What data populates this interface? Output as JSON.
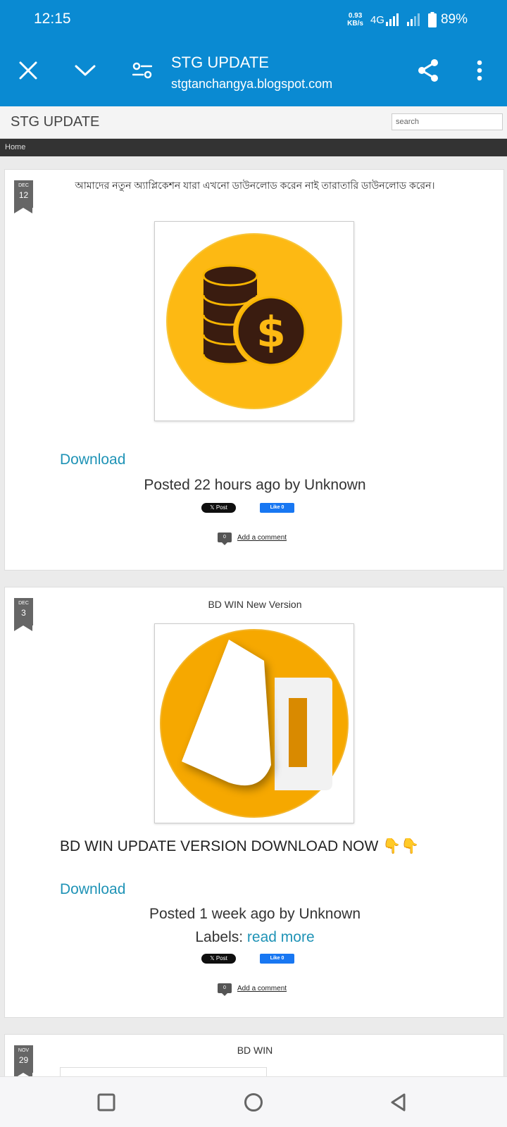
{
  "status_bar": {
    "time": "12:15",
    "net_speed_value": "0.93",
    "net_speed_unit": "KB/s",
    "network": "4G",
    "battery": "89%"
  },
  "toolbar": {
    "title": "STG UPDATE",
    "url": "stgtanchangya.blogspot.com"
  },
  "blog": {
    "title": "STG UPDATE",
    "search_placeholder": "search",
    "nav_home": "Home"
  },
  "posts": [
    {
      "month": "DEC",
      "day": "12",
      "title": "আমাদের নতুন অ্যাপ্লিকেশন যারা এখনো ডাউনলোড করেন নাই তারাতারি ডাউনলোড করেন।",
      "download": "Download",
      "posted": "Posted 22 hours ago by Unknown",
      "x_post": "𝕏 Post",
      "fb_like": "Like 0",
      "comment_count": "0",
      "add_comment": "Add a comment"
    },
    {
      "month": "DEC",
      "day": "3",
      "title": "BD WIN New Version",
      "body": "BD WIN UPDATE VERSION DOWNLOAD NOW 👇👇",
      "download": "Download",
      "posted": "Posted 1 week ago by Unknown",
      "labels_prefix": "Labels: ",
      "labels_link": "read more",
      "x_post": "𝕏 Post",
      "fb_like": "Like 0",
      "comment_count": "0",
      "add_comment": "Add a comment"
    },
    {
      "month": "NOV",
      "day": "29",
      "title": "BD WIN"
    }
  ],
  "colors": {
    "brand_blue": "#0a8ad2",
    "link_teal": "#1f93b6",
    "coin_yellow": "#fdb913",
    "bd_orange": "#f6a800"
  }
}
